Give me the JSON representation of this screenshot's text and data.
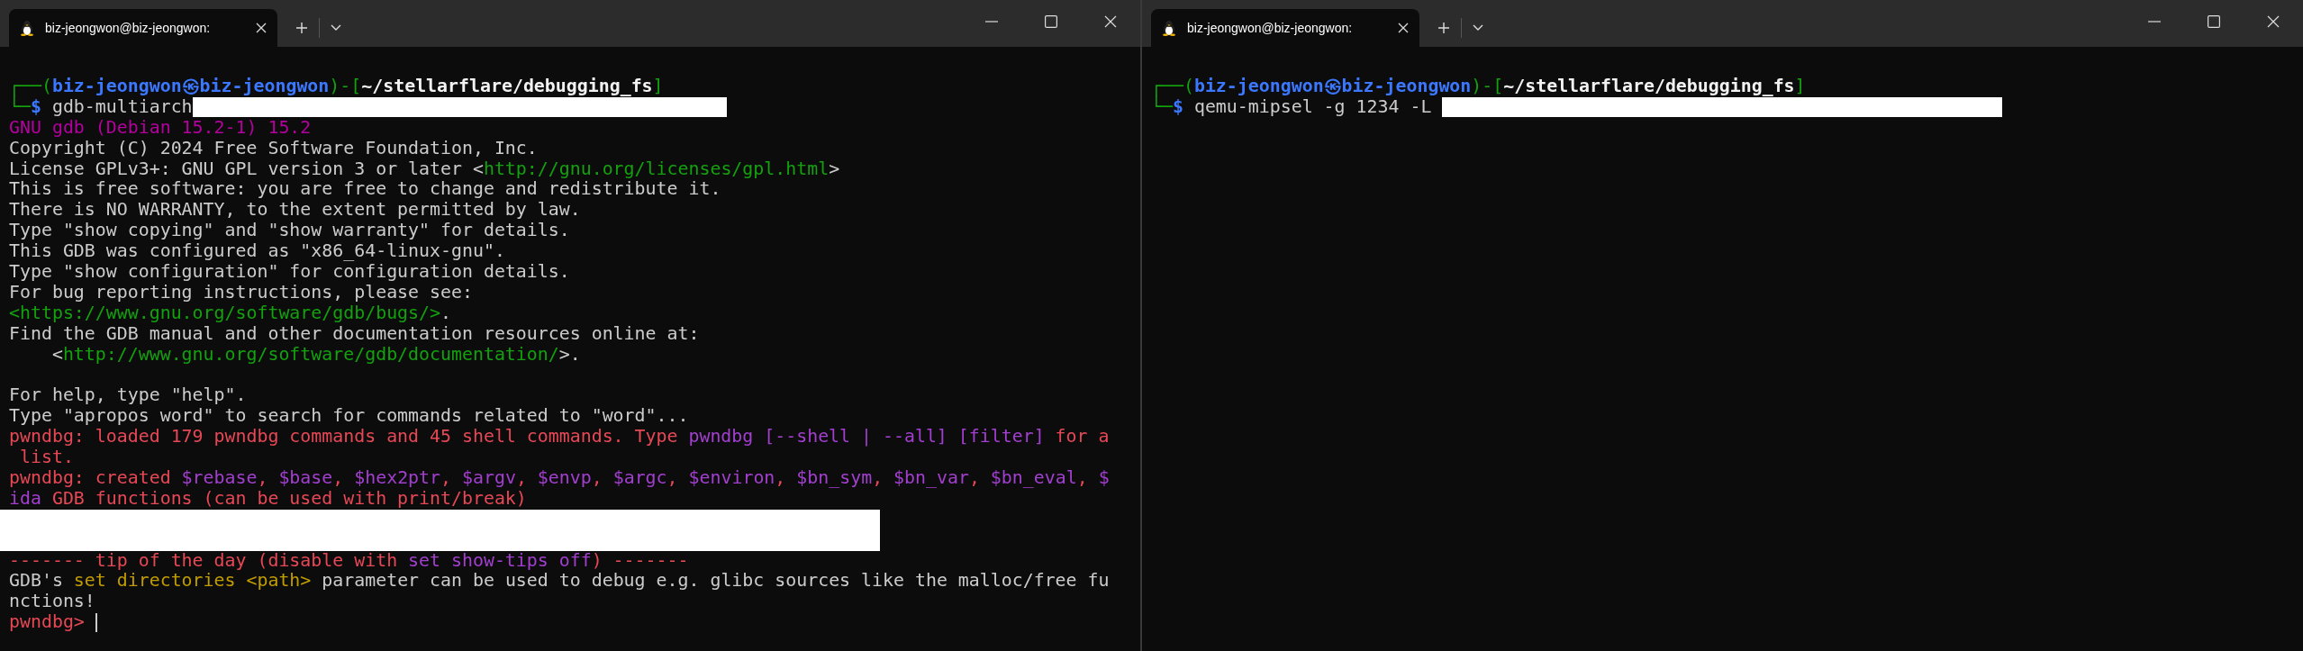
{
  "windows": [
    {
      "tab": {
        "title": "biz-jeongwon@biz-jeongwon:",
        "selected": true
      },
      "lines": [
        {
          "kind": "text",
          "segments": [
            {
              "text": "┌──(",
              "kind": "frame"
            },
            {
              "text": "biz-jeongwon㉿biz-jeongwon",
              "kind": "user"
            },
            {
              "text": ")-[",
              "kind": "frame"
            },
            {
              "text": "~/stellarflare/debugging_fs",
              "kind": "path"
            },
            {
              "text": "]",
              "kind": "frame"
            }
          ]
        },
        {
          "kind": "text",
          "segments": [
            {
              "text": "└─",
              "kind": "frame"
            },
            {
              "text": "$",
              "kind": "user"
            },
            {
              "text": " gdb-multiarch",
              "kind": "plain"
            },
            {
              "kind": "redacted"
            }
          ]
        },
        {
          "kind": "text",
          "segments": [
            {
              "text": "GNU gdb (Debian 15.2-1) 15.2",
              "kind": "banner"
            }
          ]
        },
        {
          "kind": "text",
          "segments": [
            {
              "text": "Copyright (C) 2024 Free Software Foundation, Inc.",
              "kind": "plain"
            }
          ]
        },
        {
          "kind": "text",
          "segments": [
            {
              "text": "License GPLv3+: GNU GPL version 3 or later <",
              "kind": "plain"
            },
            {
              "text": "http://gnu.org/licenses/gpl.html",
              "kind": "link"
            },
            {
              "text": ">",
              "kind": "plain"
            }
          ]
        },
        {
          "kind": "text",
          "segments": [
            {
              "text": "This is free software: you are free to change and redistribute it.",
              "kind": "plain"
            }
          ]
        },
        {
          "kind": "text",
          "segments": [
            {
              "text": "There is NO WARRANTY, to the extent permitted by law.",
              "kind": "plain"
            }
          ]
        },
        {
          "kind": "text",
          "segments": [
            {
              "text": "Type \"show copying\" and \"show warranty\" for details.",
              "kind": "plain"
            }
          ]
        },
        {
          "kind": "text",
          "segments": [
            {
              "text": "This GDB was configured as \"x86_64-linux-gnu\".",
              "kind": "plain"
            }
          ]
        },
        {
          "kind": "text",
          "segments": [
            {
              "text": "Type \"show configuration\" for configuration details.",
              "kind": "plain"
            }
          ]
        },
        {
          "kind": "text",
          "segments": [
            {
              "text": "For bug reporting instructions, please see:",
              "kind": "plain"
            }
          ]
        },
        {
          "kind": "text",
          "segments": [
            {
              "text": "<https://www.gnu.org/software/gdb/bugs/>",
              "kind": "link"
            },
            {
              "text": ".",
              "kind": "plain"
            }
          ]
        },
        {
          "kind": "text",
          "segments": [
            {
              "text": "Find the GDB manual and other documentation resources online at:",
              "kind": "plain"
            }
          ]
        },
        {
          "kind": "text",
          "segments": [
            {
              "text": "    <",
              "kind": "plain"
            },
            {
              "text": "http://www.gnu.org/software/gdb/documentation/",
              "kind": "link"
            },
            {
              "text": ">.",
              "kind": "plain"
            }
          ]
        },
        {
          "kind": "blank"
        },
        {
          "kind": "text",
          "segments": [
            {
              "text": "For help, type \"help\".",
              "kind": "plain"
            }
          ]
        },
        {
          "kind": "text",
          "segments": [
            {
              "text": "Type \"apropos word\" to search for commands related to \"word\"...",
              "kind": "plain"
            }
          ]
        },
        {
          "kind": "text",
          "segments": [
            {
              "text": "pwndbg: loaded 179 pwndbg commands and 45 shell commands. Type ",
              "kind": "pwndbg"
            },
            {
              "text": "pwndbg [--shell | --all] [filter]",
              "kind": "arg"
            },
            {
              "text": " for a",
              "kind": "pwndbg"
            }
          ]
        },
        {
          "kind": "text",
          "segments": [
            {
              "text": " list.",
              "kind": "pwndbg"
            }
          ]
        },
        {
          "kind": "text",
          "segments": [
            {
              "text": "pwndbg: created ",
              "kind": "pwndbg"
            },
            {
              "text": "$rebase",
              "kind": "arg"
            },
            {
              "text": ", ",
              "kind": "pwndbg"
            },
            {
              "text": "$base",
              "kind": "arg"
            },
            {
              "text": ", ",
              "kind": "pwndbg"
            },
            {
              "text": "$hex2ptr",
              "kind": "arg"
            },
            {
              "text": ", ",
              "kind": "pwndbg"
            },
            {
              "text": "$argv",
              "kind": "arg"
            },
            {
              "text": ", ",
              "kind": "pwndbg"
            },
            {
              "text": "$envp",
              "kind": "arg"
            },
            {
              "text": ", ",
              "kind": "pwndbg"
            },
            {
              "text": "$argc",
              "kind": "arg"
            },
            {
              "text": ", ",
              "kind": "pwndbg"
            },
            {
              "text": "$environ",
              "kind": "arg"
            },
            {
              "text": ", ",
              "kind": "pwndbg"
            },
            {
              "text": "$bn_sym",
              "kind": "arg"
            },
            {
              "text": ", ",
              "kind": "pwndbg"
            },
            {
              "text": "$bn_var",
              "kind": "arg"
            },
            {
              "text": ", ",
              "kind": "pwndbg"
            },
            {
              "text": "$bn_eval",
              "kind": "arg"
            },
            {
              "text": ", ",
              "kind": "pwndbg"
            },
            {
              "text": "$",
              "kind": "arg"
            }
          ]
        },
        {
          "kind": "text",
          "segments": [
            {
              "text": "ida",
              "kind": "arg"
            },
            {
              "text": " GDB functions (can be used with print/break)",
              "kind": "pwndbg"
            }
          ]
        },
        {
          "kind": "redacted"
        },
        {
          "kind": "text",
          "segments": [
            {
              "text": "------- tip of the day (disable with ",
              "kind": "pwndbg"
            },
            {
              "text": "set show-tips off",
              "kind": "arg"
            },
            {
              "text": ") -------",
              "kind": "pwndbg"
            }
          ]
        },
        {
          "kind": "text",
          "segments": [
            {
              "text": "GDB's ",
              "kind": "plain"
            },
            {
              "text": "set directories <path>",
              "kind": "hint"
            },
            {
              "text": " parameter can be used to debug e.g. glibc sources like the malloc/free fu",
              "kind": "plain"
            }
          ]
        },
        {
          "kind": "text",
          "segments": [
            {
              "text": "nctions!",
              "kind": "plain"
            }
          ]
        },
        {
          "kind": "text",
          "cursor": true,
          "segments": [
            {
              "text": "pwndbg> ",
              "kind": "pwndbg"
            }
          ]
        }
      ]
    },
    {
      "tab": {
        "title": "biz-jeongwon@biz-jeongwon:",
        "selected": true
      },
      "lines": [
        {
          "kind": "text",
          "segments": [
            {
              "text": "┌──(",
              "kind": "frame"
            },
            {
              "text": "biz-jeongwon㉿biz-jeongwon",
              "kind": "user"
            },
            {
              "text": ")-[",
              "kind": "frame"
            },
            {
              "text": "~/stellarflare/debugging_fs",
              "kind": "path"
            },
            {
              "text": "]",
              "kind": "frame"
            }
          ]
        },
        {
          "kind": "text",
          "segments": [
            {
              "text": "└─",
              "kind": "frame"
            },
            {
              "text": "$",
              "kind": "user"
            },
            {
              "text": " qemu-mipsel -g 1234 -L ",
              "kind": "plain"
            },
            {
              "kind": "redacted"
            }
          ]
        }
      ]
    }
  ]
}
